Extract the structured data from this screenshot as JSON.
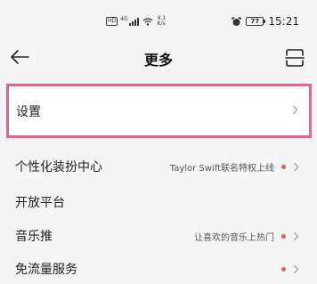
{
  "status_bar": {
    "hd": "HD",
    "signal": "4G",
    "speed_value": "4.1",
    "speed_unit": "K/s",
    "battery": "77",
    "time": "15:21"
  },
  "header": {
    "title": "更多"
  },
  "settings_row": {
    "label": "设置"
  },
  "rows": [
    {
      "label": "个性化装扮中心",
      "hint": "Taylor Swift联名特权上线",
      "dot": true,
      "chevron": true
    },
    {
      "label": "开放平台",
      "hint": "",
      "dot": false,
      "chevron": false
    },
    {
      "label": "音乐推",
      "hint": "让喜欢的音乐上热门",
      "dot": true,
      "chevron": true
    },
    {
      "label": "免流量服务",
      "hint": "",
      "dot": true,
      "chevron": true
    }
  ],
  "colors": {
    "highlight_border": "#e8628f",
    "notification_dot": "#e85a5a"
  }
}
